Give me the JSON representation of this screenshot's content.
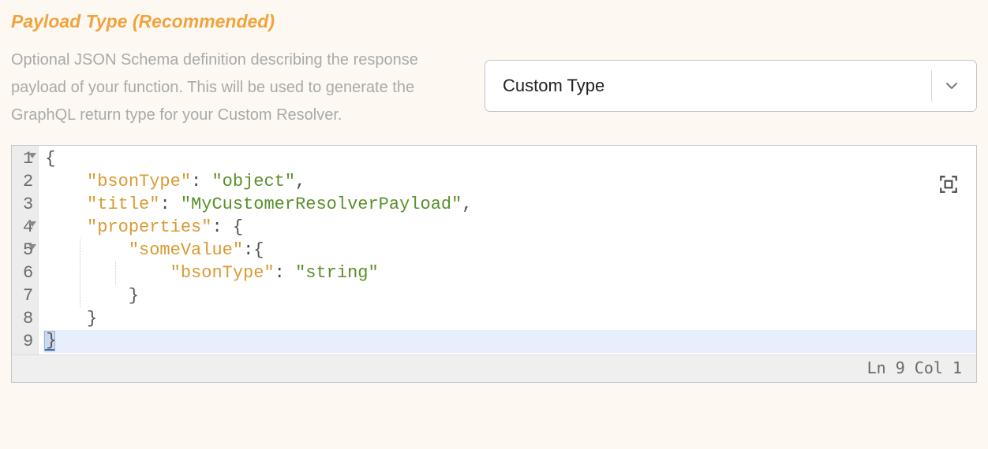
{
  "section": {
    "title": "Payload Type (Recommended)",
    "description": "Optional JSON Schema definition describing the response payload of your function. This will be used to generate the GraphQL return type for your Custom Resolver."
  },
  "select": {
    "value": "Custom Type"
  },
  "editor": {
    "lines": [
      {
        "n": 1,
        "fold": true,
        "indent": 0,
        "tokens": [
          {
            "t": "brace",
            "v": "{"
          }
        ]
      },
      {
        "n": 2,
        "fold": false,
        "indent": 1,
        "tokens": [
          {
            "t": "key",
            "v": "\"bsonType\""
          },
          {
            "t": "plain",
            "v": ": "
          },
          {
            "t": "str",
            "v": "\"object\""
          },
          {
            "t": "plain",
            "v": ","
          }
        ]
      },
      {
        "n": 3,
        "fold": false,
        "indent": 1,
        "tokens": [
          {
            "t": "key",
            "v": "\"title\""
          },
          {
            "t": "plain",
            "v": ": "
          },
          {
            "t": "str",
            "v": "\"MyCustomerResolverPayload\""
          },
          {
            "t": "plain",
            "v": ","
          }
        ]
      },
      {
        "n": 4,
        "fold": true,
        "indent": 1,
        "tokens": [
          {
            "t": "key",
            "v": "\"properties\""
          },
          {
            "t": "plain",
            "v": ": "
          },
          {
            "t": "brace",
            "v": "{"
          }
        ]
      },
      {
        "n": 5,
        "fold": true,
        "indent": 2,
        "tokens": [
          {
            "t": "key",
            "v": "\"someValue\""
          },
          {
            "t": "plain",
            "v": ":"
          },
          {
            "t": "brace",
            "v": "{"
          }
        ]
      },
      {
        "n": 6,
        "fold": false,
        "indent": 3,
        "tokens": [
          {
            "t": "key",
            "v": "\"bsonType\""
          },
          {
            "t": "plain",
            "v": ": "
          },
          {
            "t": "str",
            "v": "\"string\""
          }
        ]
      },
      {
        "n": 7,
        "fold": false,
        "indent": 2,
        "tokens": [
          {
            "t": "brace",
            "v": "}"
          }
        ]
      },
      {
        "n": 8,
        "fold": false,
        "indent": 1,
        "tokens": [
          {
            "t": "brace",
            "v": "}"
          }
        ]
      },
      {
        "n": 9,
        "fold": false,
        "indent": 0,
        "active": true,
        "cursor": true,
        "tokens": []
      }
    ],
    "status": {
      "line": 9,
      "col": 1,
      "text": "Ln 9 Col 1"
    }
  }
}
